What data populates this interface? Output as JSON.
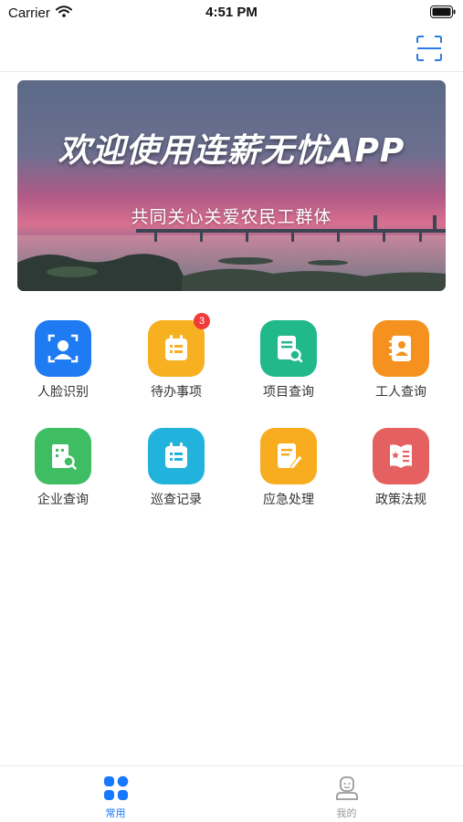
{
  "status_bar": {
    "carrier": "Carrier",
    "time": "4:51 PM"
  },
  "header": {
    "scan_icon": "scan-icon"
  },
  "banner": {
    "title": "欢迎使用连薪无忧APP",
    "subtitle": "共同关心关爱农民工群体"
  },
  "grid": {
    "items": [
      {
        "label": "人脸识别",
        "icon": "face-recognition-icon",
        "color": "#1f7bf2"
      },
      {
        "label": "待办事项",
        "icon": "todo-icon",
        "color": "#f7b01f",
        "badge": "3"
      },
      {
        "label": "项目查询",
        "icon": "project-search-icon",
        "color": "#22b98a"
      },
      {
        "label": "工人查询",
        "icon": "worker-search-icon",
        "color": "#f5921f"
      },
      {
        "label": "企业查询",
        "icon": "company-search-icon",
        "color": "#3fbd63"
      },
      {
        "label": "巡查记录",
        "icon": "inspection-record-icon",
        "color": "#22b3dd"
      },
      {
        "label": "应急处理",
        "icon": "emergency-icon",
        "color": "#f7ad1f"
      },
      {
        "label": "政策法规",
        "icon": "policy-icon",
        "color": "#e56060"
      }
    ]
  },
  "tab_bar": {
    "tabs": [
      {
        "label": "常用",
        "icon": "grid-apps-icon",
        "active": true
      },
      {
        "label": "我的",
        "icon": "profile-icon",
        "active": false
      }
    ]
  },
  "colors": {
    "accent": "#1677ff",
    "tab_inactive": "#999999"
  }
}
